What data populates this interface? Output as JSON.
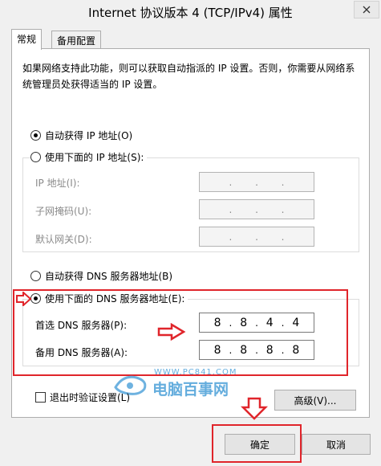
{
  "window": {
    "title": "Internet 协议版本 4 (TCP/IPv4) 属性"
  },
  "tabs": [
    {
      "label": "常规"
    },
    {
      "label": "备用配置"
    }
  ],
  "description": "如果网络支持此功能，则可以获取自动指派的 IP 设置。否则，你需要从网络系统管理员处获得适当的 IP 设置。",
  "ip": {
    "auto_label": "自动获得 IP 地址(O)",
    "manual_label": "使用下面的 IP 地址(S):",
    "fields": [
      {
        "label": "IP 地址(I):"
      },
      {
        "label": "子网掩码(U):"
      },
      {
        "label": "默认网关(D):"
      }
    ]
  },
  "dns": {
    "auto_label": "自动获得 DNS 服务器地址(B)",
    "manual_label": "使用下面的 DNS 服务器地址(E):",
    "preferred_label": "首选 DNS 服务器(P):",
    "preferred_octets": [
      "8",
      "8",
      "4",
      "4"
    ],
    "alternate_label": "备用 DNS 服务器(A):",
    "alternate_octets": [
      "8",
      "8",
      "8",
      "8"
    ]
  },
  "validate_label": "退出时验证设置(L)",
  "advanced_label": "高级(V)...",
  "ok_label": "确定",
  "cancel_label": "取消",
  "watermark": {
    "url": "WWW.PC841.COM",
    "name": "电脑百事网"
  },
  "colors": {
    "highlight": "#e0252b",
    "watermark": "#4a9fd8"
  }
}
